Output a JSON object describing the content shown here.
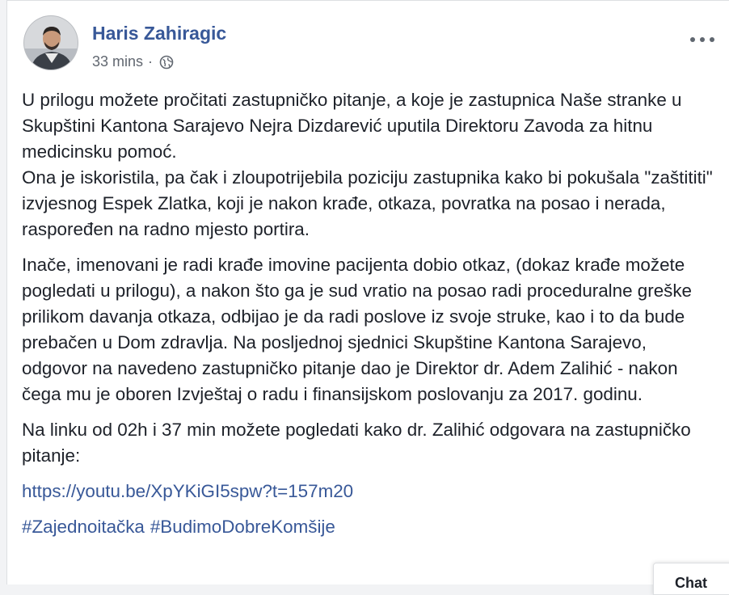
{
  "post": {
    "author": "Haris Zahiragic",
    "time": "33 mins",
    "separator": "·",
    "privacy_icon": "globe-icon",
    "more_icon": "ellipsis-icon",
    "paragraphs": [
      [
        "U prilogu možete pročitati zastupničko pitanje, a koje je zastupnica Naše stranke u Skupštini Kantona Sarajevo Nejra Dizdarević uputila Direktoru Zavoda za hitnu medicinsku pomoć.",
        "Ona je iskoristila, pa čak i zloupotrijebila poziciju zastupnika kako bi pokušala \"zaštititi\" izvjesnog Espek Zlatka, koji je nakon krađe, otkaza, povratka na posao i nerada, raspoređen na radno mjesto portira."
      ],
      [
        "Inače, imenovani je radi krađe imovine pacijenta dobio otkaz, (dokaz krađe možete pogledati u prilogu), a nakon što ga je sud vratio na posao radi proceduralne greške prilikom davanja otkaza, odbijao je da radi poslove iz svoje struke, kao i to da bude prebačen u Dom zdravlja. Na posljednoj sjednici Skupštine Kantona Sarajevo, odgovor na navedeno zastupničko pitanje dao je Direktor dr. Adem Zalihić - nakon čega mu je oboren Izvještaj o radu i finansijskom poslovanju za 2017. godinu."
      ],
      [
        "Na linku od 02h i 37 min možete pogledati kako dr. Zalihić odgovara na zastupničko pitanje:"
      ]
    ],
    "link": "https://youtu.be/XpYKiGI5spw?t=157m20",
    "hashtags": [
      "#Zajednoitačka",
      "#BudimoDobreKomšije"
    ]
  },
  "chat_tab": {
    "label": "Chat"
  },
  "colors": {
    "link": "#385898",
    "text": "#1d2129",
    "meta": "#616770",
    "background": "#f2f3f5"
  }
}
